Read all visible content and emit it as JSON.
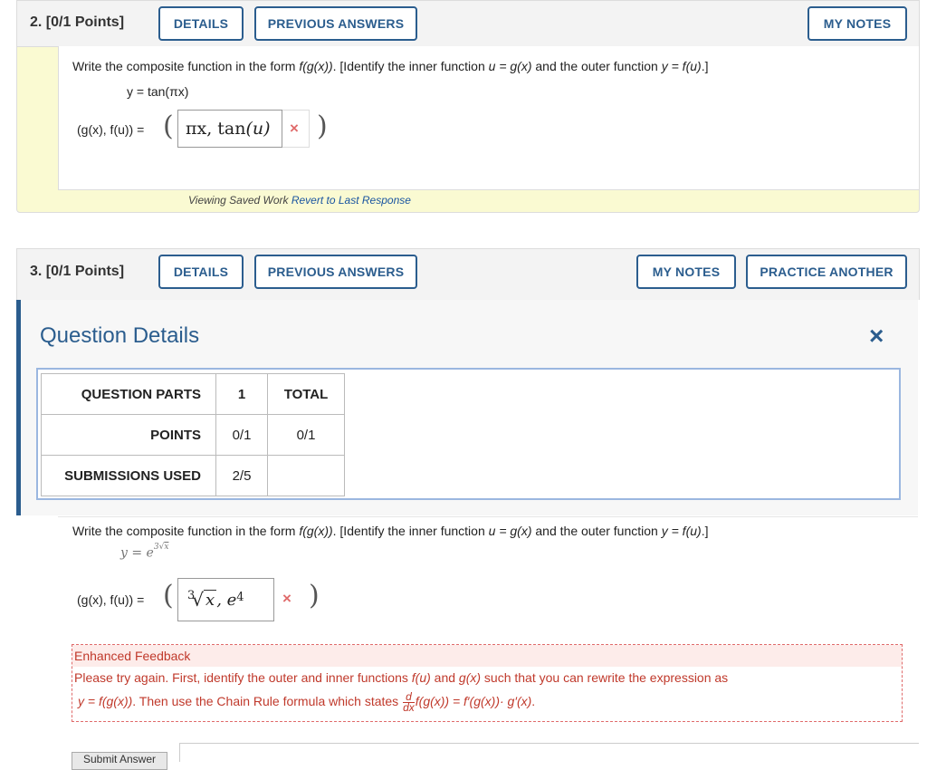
{
  "q2": {
    "number": "2.",
    "points": "[0/1 Points]",
    "buttons": {
      "details": "DETAILS",
      "previous": "PREVIOUS ANSWERS",
      "notes": "MY NOTES"
    },
    "prompt_a": "Write the composite function in the form ",
    "prompt_fg": "f(g(x))",
    "prompt_b": ". [Identify the inner function ",
    "prompt_u": "u = g(x)",
    "prompt_c": " and the outer function ",
    "prompt_y": "y = f(u)",
    "prompt_d": ".]",
    "equation": "y = tan(πx)",
    "pair_label": "(g(x), f(u)) =",
    "answer_a": "πx, tan",
    "answer_b": "(u)",
    "result_mark": "×",
    "viewing": "Viewing Saved Work",
    "revert": "Revert to Last Response"
  },
  "q3": {
    "number": "3.",
    "points": "[0/1 Points]",
    "buttons": {
      "details": "DETAILS",
      "previous": "PREVIOUS ANSWERS",
      "notes": "MY NOTES",
      "practice": "PRACTICE ANOTHER"
    },
    "details_title": "Question Details",
    "close": "×",
    "table": {
      "row1": [
        "QUESTION PARTS",
        "1",
        "TOTAL"
      ],
      "row2": [
        "POINTS",
        "0/1",
        "0/1"
      ],
      "row3": [
        "SUBMISSIONS USED",
        "2/5",
        ""
      ]
    },
    "prompt_a": "Write the composite function in the form ",
    "prompt_fg": "f(g(x))",
    "prompt_b": ". [Identify the inner function ",
    "prompt_u": "u = g(x)",
    "prompt_c": " and the outer function ",
    "prompt_y": "y = f(u)",
    "prompt_d": ".]",
    "equation_base": "y = e",
    "equation_exp_index": "3",
    "equation_exp_rad": "x",
    "pair_label": "(g(x), f(u)) =",
    "answer_index": "3",
    "answer_rad": "x",
    "answer_sep": " , e",
    "answer_exp": "4",
    "result_mark": "×",
    "feedback": {
      "title": "Enhanced Feedback",
      "line1a": "Please try again. First, identify the outer and inner functions ",
      "line1b": "f(u)",
      "line1c": " and ",
      "line1d": "g(x)",
      "line1e": " such that you can rewrite the expression as",
      "line2a": "y = f(g(x))",
      "line2b": ". Then use the Chain Rule formula which states ",
      "d_num": "d",
      "d_den": "dx",
      "line2c": "f(g(x)) = f′(g(x))· g′(x)",
      "line2d": "."
    },
    "submit": "Submit Answer"
  }
}
